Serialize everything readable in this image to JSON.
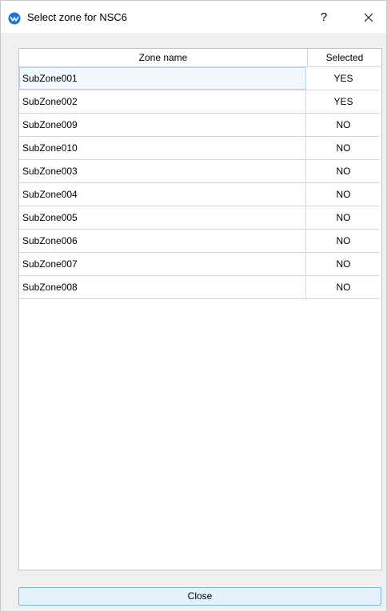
{
  "window": {
    "title": "Select zone for NSC6",
    "help_label": "?"
  },
  "table": {
    "columns": [
      "Zone name",
      "Selected"
    ],
    "rows": [
      {
        "zone": "SubZone001",
        "selected": "YES"
      },
      {
        "zone": "SubZone002",
        "selected": "YES"
      },
      {
        "zone": "SubZone009",
        "selected": "NO"
      },
      {
        "zone": "SubZone010",
        "selected": "NO"
      },
      {
        "zone": "SubZone003",
        "selected": "NO"
      },
      {
        "zone": "SubZone004",
        "selected": "NO"
      },
      {
        "zone": "SubZone005",
        "selected": "NO"
      },
      {
        "zone": "SubZone006",
        "selected": "NO"
      },
      {
        "zone": "SubZone007",
        "selected": "NO"
      },
      {
        "zone": "SubZone008",
        "selected": "NO"
      }
    ]
  },
  "footer": {
    "close_label": "Close"
  },
  "icons": {
    "app": "app-logo-icon",
    "close": "close-icon"
  },
  "colors": {
    "app_icon": "#1b76d1",
    "button_border": "#7eb4ea",
    "button_fill": "#e5f1fb"
  }
}
